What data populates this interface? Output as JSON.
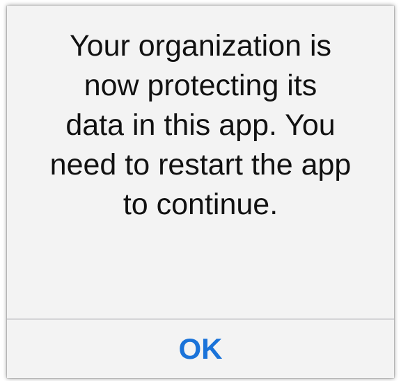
{
  "alert": {
    "message_lines": [
      "Your organization is",
      "now protecting its",
      "data in this app. You",
      "need to restart the app",
      "to continue."
    ],
    "ok_label": "OK"
  },
  "colors": {
    "background": "#f3f3f3",
    "text": "#111111",
    "button": "#1a73d9",
    "divider": "#d4d4d6"
  }
}
